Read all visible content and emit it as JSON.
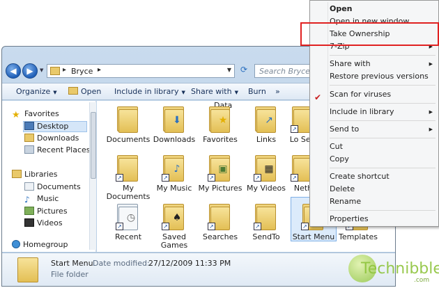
{
  "address": {
    "crumb": "Bryce",
    "search_placeholder": "Search Bryce"
  },
  "toolbar": {
    "organize": "Organize",
    "open": "Open",
    "include": "Include in library",
    "share": "Share with",
    "burn": "Burn",
    "more": "»"
  },
  "nav": {
    "favorites": "Favorites",
    "desktop": "Desktop",
    "downloads": "Downloads",
    "recent": "Recent Places",
    "libraries": "Libraries",
    "documents": "Documents",
    "music": "Music",
    "pictures": "Pictures",
    "videos": "Videos",
    "homegroup": "Homegroup"
  },
  "content": {
    "partial_label": "Data",
    "tiles": [
      {
        "label": "Documents"
      },
      {
        "label": "Downloads"
      },
      {
        "label": "Favorites"
      },
      {
        "label": "Links"
      },
      {
        "label": "Lo Sett"
      },
      {
        "label": "My Documents"
      },
      {
        "label": "My Music"
      },
      {
        "label": "My Pictures"
      },
      {
        "label": "My Videos"
      },
      {
        "label": "Neth"
      },
      {
        "label": "Recent"
      },
      {
        "label": "Saved Games"
      },
      {
        "label": "Searches"
      },
      {
        "label": "SendTo"
      },
      {
        "label": "Start Menu"
      },
      {
        "label": "Templates"
      }
    ]
  },
  "details": {
    "name": "Start Menu",
    "modified_label": "Date modified:",
    "modified_value": "27/12/2009 11:33 PM",
    "type": "File folder"
  },
  "context_menu": {
    "open": "Open",
    "open_new": "Open in new window",
    "take_ownership": "Take Ownership",
    "zip": "7-Zip",
    "share_with": "Share with",
    "restore": "Restore previous versions",
    "scan": "Scan for viruses",
    "include": "Include in library",
    "send_to": "Send to",
    "cut": "Cut",
    "copy": "Copy",
    "create_shortcut": "Create shortcut",
    "delete": "Delete",
    "rename": "Rename",
    "properties": "Properties"
  },
  "watermark": {
    "brand": "Technibble",
    "suffix": ".com"
  },
  "colors": {
    "highlight_box": "#e02020",
    "selection": "#dcebfb",
    "folder": "#e9c96a"
  }
}
